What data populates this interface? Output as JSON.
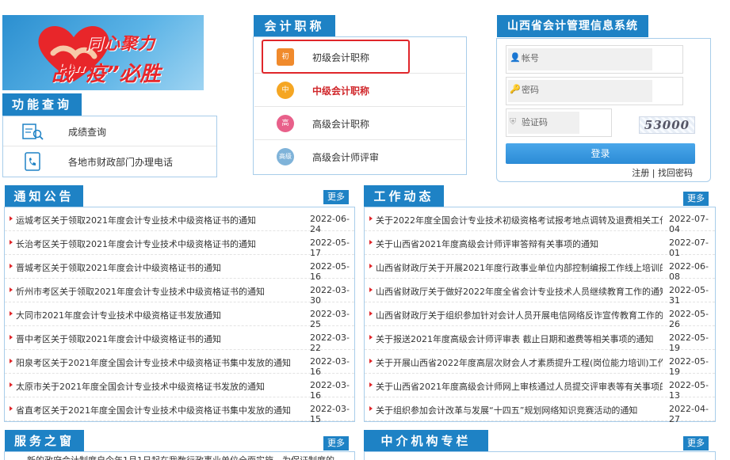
{
  "banner": {
    "line1": "同心聚力",
    "line2": "战“疫”必胜"
  },
  "func": {
    "title": "功能查询",
    "items": [
      {
        "label": "成绩查询",
        "icon": "score-search-icon"
      },
      {
        "label": "各地市财政部门办理电话",
        "icon": "phone-book-icon"
      }
    ]
  },
  "titles": {
    "title": "会计职称",
    "items": [
      {
        "label": "初级会计职称",
        "badge": "初",
        "color": "#f08a2c"
      },
      {
        "label": "中级会计职称",
        "badge": "中",
        "color": "#f5a623"
      },
      {
        "label": "高级会计职称",
        "badge": "高",
        "color": "#e8608a"
      },
      {
        "label": "高级会计师评审",
        "badge": "高级",
        "color": "#7fb3d9"
      }
    ]
  },
  "login": {
    "title": "山西省会计管理信息系统",
    "account_placeholder": "帐号",
    "password_placeholder": "密码",
    "captcha_placeholder": "验证码",
    "captcha_code": "53000",
    "button": "登录",
    "register": "注册",
    "separator": "|",
    "forgot": "找回密码"
  },
  "notices": {
    "title": "通知公告",
    "more": "更多",
    "items": [
      {
        "text": "运城考区关于领取2021年度会计专业技术中级资格证书的通知",
        "date": "2022-06-24"
      },
      {
        "text": "长治考区关于领取2021年度会计专业技术中级资格证书的通知",
        "date": "2022-05-17"
      },
      {
        "text": "晋城考区关于领取2021年度会计中级资格证书的通知",
        "date": "2022-05-16"
      },
      {
        "text": "忻州市考区关于领取2021年度会计专业技术中级资格证书的通知",
        "date": "2022-03-30"
      },
      {
        "text": "大同市2021年度会计专业技术中级资格证书发放通知",
        "date": "2022-03-25"
      },
      {
        "text": "晋中考区关于领取2021年度会计中级资格证书的通知",
        "date": "2022-03-22"
      },
      {
        "text": "阳泉考区关于2021年度全国会计专业技术中级资格证书集中发放的通知",
        "date": "2022-03-16"
      },
      {
        "text": "太原市关于2021年度全国会计专业技术中级资格证书发放的通知",
        "date": "2022-03-16"
      },
      {
        "text": "省直考区关于2021年度全国会计专业技术中级资格证书集中发放的通知",
        "date": "2022-03-15"
      }
    ]
  },
  "work": {
    "title": "工作动态",
    "more": "更多",
    "items": [
      {
        "text": "关于2022年度全国会计专业技术初级资格考试报考地点调转及退费相关工作...",
        "date": "2022-07-04"
      },
      {
        "text": "关于山西省2021年度高级会计师评审答辩有关事项的通知",
        "date": "2022-07-01"
      },
      {
        "text": "山西省财政厅关于开展2021年度行政事业单位内部控制编报工作线上培训的...",
        "date": "2022-06-08"
      },
      {
        "text": "山西省财政厅关于做好2022年度全省会计专业技术人员继续教育工作的通知",
        "date": "2022-05-31"
      },
      {
        "text": "山西省财政厅关于组织参加针对会计人员开展电信网络反诈宣传教育工作的...",
        "date": "2022-05-26"
      },
      {
        "text": "关于报送2021年度高级会计师评审表 截止日期和邀费等相关事项的通知",
        "date": "2022-05-19"
      },
      {
        "text": "关于开展山西省2022年度高层次财会人才素质提升工程(岗位能力培训)工作...",
        "date": "2022-05-19"
      },
      {
        "text": "关于山西省2021年度高级会计师网上审核通过人员提交评审表等有关事项的...",
        "date": "2022-05-13"
      },
      {
        "text": "关于组织参加会计改革与发展“十四五”规划网络知识竞赛活动的通知",
        "date": "2022-04-27"
      }
    ]
  },
  "service": {
    "title": "服务之窗",
    "more": "更多",
    "preview": "新的政府会计制度自今年1月1日起在我数行政事业单位全面实施，为保证制度的"
  },
  "agency": {
    "title": "中介机构专栏",
    "more": "更多"
  }
}
